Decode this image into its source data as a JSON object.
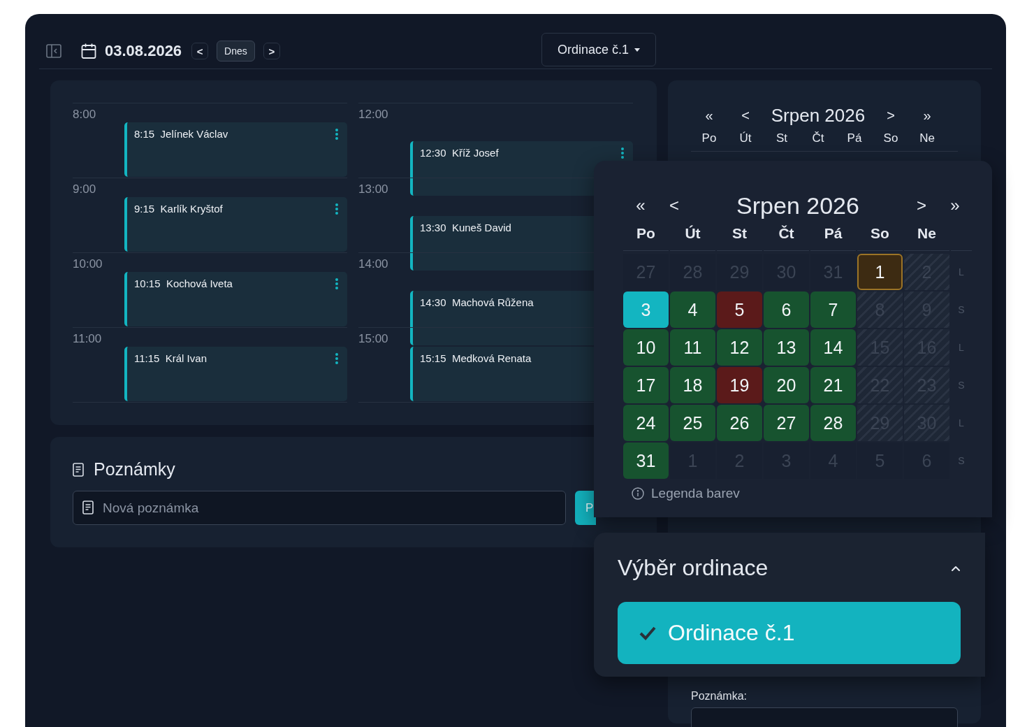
{
  "toolbar": {
    "date": "03.08.2026",
    "prev": "<",
    "today_button": "Dnes",
    "next": ">",
    "practice_dropdown": "Ordinace č.1"
  },
  "schedule": {
    "columns": [
      {
        "hours": [
          {
            "label": "8:00",
            "appointments": [
              {
                "time": "8:15",
                "name": "Jelínek Václav",
                "menu_icon": true
              }
            ]
          },
          {
            "label": "9:00",
            "appointments": [
              {
                "time": "9:15",
                "name": "Karlík Kryštof",
                "menu_icon": true
              }
            ]
          },
          {
            "label": "10:00",
            "appointments": [
              {
                "time": "10:15",
                "name": "Kochová Iveta",
                "menu_icon": true
              }
            ]
          },
          {
            "label": "11:00",
            "appointments": [
              {
                "time": "11:15",
                "name": "Král Ivan",
                "menu_icon": true
              }
            ]
          }
        ]
      },
      {
        "hours": [
          {
            "label": "12:00",
            "appointments": [
              {
                "time": "12:30",
                "name": "Kříž Josef",
                "menu_icon": true
              }
            ]
          },
          {
            "label": "13:00",
            "appointments": [
              {
                "time": "13:30",
                "name": "Kuneš David",
                "menu_icon": false
              }
            ]
          },
          {
            "label": "14:00",
            "appointments": [
              {
                "time": "14:30",
                "name": "Machová Růžena",
                "menu_icon": false
              }
            ]
          },
          {
            "label": "15:00",
            "appointments": [
              {
                "time": "15:15",
                "name": "Medková Renata",
                "menu_icon": false
              }
            ]
          }
        ]
      }
    ]
  },
  "notes": {
    "title": "Poznámky",
    "placeholder": "Nová poznámka",
    "button": "P"
  },
  "side_panel": {
    "calendar": {
      "prev_year": "«",
      "prev": "<",
      "title": "Srpen 2026",
      "next": ">",
      "next_year": "»",
      "weekdays": [
        "Po",
        "Út",
        "St",
        "Čt",
        "Pá",
        "So",
        "Ne"
      ]
    },
    "note_label": "Poznámka:"
  },
  "calendar_popup": {
    "prev_year": "«",
    "prev": "<",
    "title": "Srpen 2026",
    "next": ">",
    "next_year": "»",
    "weekdays": [
      "Po",
      "Út",
      "St",
      "Čt",
      "Pá",
      "So",
      "Ne"
    ],
    "weeks": [
      {
        "label": "L",
        "days": [
          {
            "day": "27",
            "kind": "outside",
            "selected": false
          },
          {
            "day": "28",
            "kind": "outside",
            "selected": false
          },
          {
            "day": "29",
            "kind": "outside",
            "selected": false
          },
          {
            "day": "30",
            "kind": "outside",
            "selected": false
          },
          {
            "day": "31",
            "kind": "outside",
            "selected": false
          },
          {
            "day": "1",
            "kind": "marked",
            "selected": false
          },
          {
            "day": "2",
            "kind": "weekend",
            "selected": false
          }
        ]
      },
      {
        "label": "S",
        "days": [
          {
            "day": "3",
            "kind": "available",
            "selected": true
          },
          {
            "day": "4",
            "kind": "available",
            "selected": false
          },
          {
            "day": "5",
            "kind": "full",
            "selected": false
          },
          {
            "day": "6",
            "kind": "available",
            "selected": false
          },
          {
            "day": "7",
            "kind": "available",
            "selected": false
          },
          {
            "day": "8",
            "kind": "weekend",
            "selected": false
          },
          {
            "day": "9",
            "kind": "weekend",
            "selected": false
          }
        ]
      },
      {
        "label": "L",
        "days": [
          {
            "day": "10",
            "kind": "available",
            "selected": false
          },
          {
            "day": "11",
            "kind": "available",
            "selected": false
          },
          {
            "day": "12",
            "kind": "available",
            "selected": false
          },
          {
            "day": "13",
            "kind": "available",
            "selected": false
          },
          {
            "day": "14",
            "kind": "available",
            "selected": false
          },
          {
            "day": "15",
            "kind": "weekend",
            "selected": false
          },
          {
            "day": "16",
            "kind": "weekend",
            "selected": false
          }
        ]
      },
      {
        "label": "S",
        "days": [
          {
            "day": "17",
            "kind": "available",
            "selected": false
          },
          {
            "day": "18",
            "kind": "available",
            "selected": false
          },
          {
            "day": "19",
            "kind": "full",
            "selected": false
          },
          {
            "day": "20",
            "kind": "available",
            "selected": false
          },
          {
            "day": "21",
            "kind": "available",
            "selected": false
          },
          {
            "day": "22",
            "kind": "weekend",
            "selected": false
          },
          {
            "day": "23",
            "kind": "weekend",
            "selected": false
          }
        ]
      },
      {
        "label": "L",
        "days": [
          {
            "day": "24",
            "kind": "available",
            "selected": false
          },
          {
            "day": "25",
            "kind": "available",
            "selected": false
          },
          {
            "day": "26",
            "kind": "available",
            "selected": false
          },
          {
            "day": "27",
            "kind": "available",
            "selected": false
          },
          {
            "day": "28",
            "kind": "available",
            "selected": false
          },
          {
            "day": "29",
            "kind": "weekend",
            "selected": false
          },
          {
            "day": "30",
            "kind": "weekend",
            "selected": false
          }
        ]
      },
      {
        "label": "S",
        "days": [
          {
            "day": "31",
            "kind": "available",
            "selected": false
          },
          {
            "day": "1",
            "kind": "outside",
            "selected": false
          },
          {
            "day": "2",
            "kind": "outside",
            "selected": false
          },
          {
            "day": "3",
            "kind": "outside",
            "selected": false
          },
          {
            "day": "4",
            "kind": "outside",
            "selected": false
          },
          {
            "day": "5",
            "kind": "outside",
            "selected": false
          },
          {
            "day": "6",
            "kind": "outside",
            "selected": false
          }
        ]
      }
    ],
    "legend": "Legenda barev"
  },
  "practice_popup": {
    "title": "Výběr ordinace",
    "expanded": true,
    "options": [
      {
        "label": "Ordinace č.1",
        "selected": true
      }
    ]
  }
}
